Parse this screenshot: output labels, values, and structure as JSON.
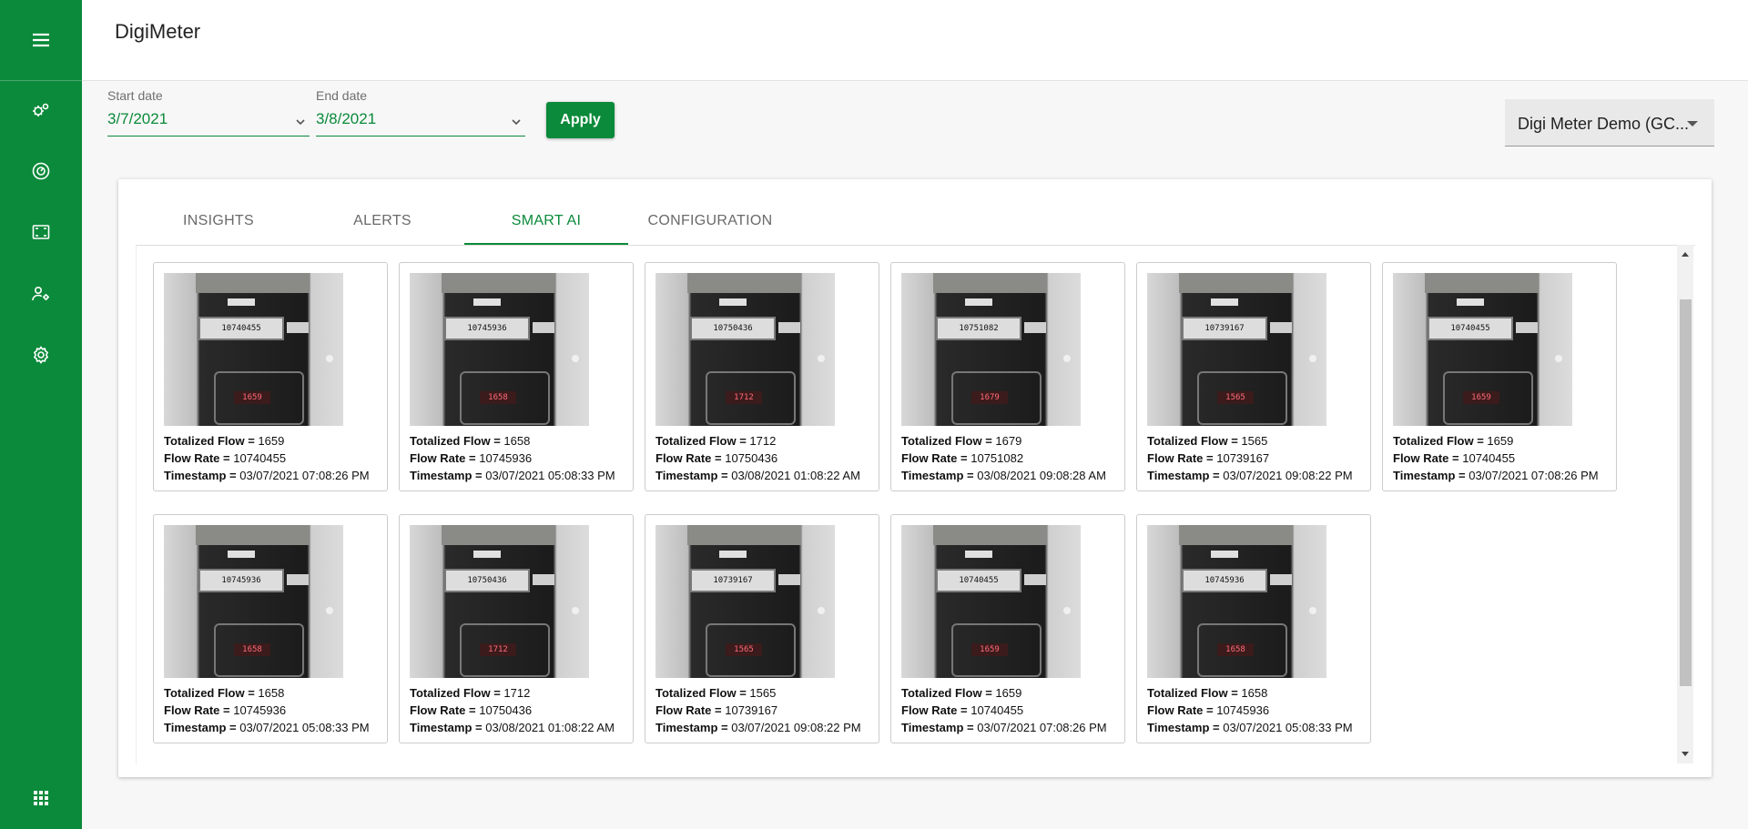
{
  "app": {
    "title": "DigiMeter"
  },
  "filters": {
    "start_date_label": "Start date",
    "start_date_value": "3/7/2021",
    "end_date_label": "End date",
    "end_date_value": "3/8/2021",
    "apply_label": "Apply"
  },
  "org_selector": {
    "value": "Digi Meter Demo (GC..."
  },
  "sidebar": {
    "items": [
      {
        "icon": "menu-icon"
      },
      {
        "icon": "gears-icon"
      },
      {
        "icon": "gauge-icon"
      },
      {
        "icon": "map-frame-icon"
      },
      {
        "icon": "user-settings-icon"
      },
      {
        "icon": "settings-icon"
      },
      {
        "icon": "apps-grid-icon"
      }
    ]
  },
  "tabs": [
    {
      "label": "INSIGHTS",
      "active": false
    },
    {
      "label": "ALERTS",
      "active": false
    },
    {
      "label": "SMART AI",
      "active": true
    },
    {
      "label": "CONFIGURATION",
      "active": false
    }
  ],
  "field_labels": {
    "totalized_flow": "Totalized Flow =",
    "flow_rate": "Flow Rate =",
    "timestamp": "Timestamp ="
  },
  "readings": [
    {
      "totalized_flow": "1659",
      "flow_rate": "10740455",
      "timestamp": "03/07/2021 07:08:26 PM",
      "counter": "10740455",
      "lcd": "1659"
    },
    {
      "totalized_flow": "1658",
      "flow_rate": "10745936",
      "timestamp": "03/07/2021 05:08:33 PM",
      "counter": "10745936",
      "lcd": "1658"
    },
    {
      "totalized_flow": "1712",
      "flow_rate": "10750436",
      "timestamp": "03/08/2021 01:08:22 AM",
      "counter": "10750436",
      "lcd": "1712"
    },
    {
      "totalized_flow": "1679",
      "flow_rate": "10751082",
      "timestamp": "03/08/2021 09:08:28 AM",
      "counter": "10751082",
      "lcd": "1679"
    },
    {
      "totalized_flow": "1565",
      "flow_rate": "10739167",
      "timestamp": "03/07/2021 09:08:22 PM",
      "counter": "10739167",
      "lcd": "1565"
    },
    {
      "totalized_flow": "1659",
      "flow_rate": "10740455",
      "timestamp": "03/07/2021 07:08:26 PM",
      "counter": "10740455",
      "lcd": "1659"
    },
    {
      "totalized_flow": "1658",
      "flow_rate": "10745936",
      "timestamp": "03/07/2021 05:08:33 PM",
      "counter": "10745936",
      "lcd": "1658"
    },
    {
      "totalized_flow": "1712",
      "flow_rate": "10750436",
      "timestamp": "03/08/2021 01:08:22 AM",
      "counter": "10750436",
      "lcd": "1712"
    },
    {
      "totalized_flow": "1565",
      "flow_rate": "10739167",
      "timestamp": "03/07/2021 09:08:22 PM",
      "counter": "10739167",
      "lcd": "1565"
    },
    {
      "totalized_flow": "1659",
      "flow_rate": "10740455",
      "timestamp": "03/07/2021 07:08:26 PM",
      "counter": "10740455",
      "lcd": "1659"
    },
    {
      "totalized_flow": "1658",
      "flow_rate": "10745936",
      "timestamp": "03/07/2021 05:08:33 PM",
      "counter": "10745936",
      "lcd": "1658"
    }
  ],
  "colors": {
    "brand": "#0a8a3a",
    "header_bg": "#ffffff",
    "page_bg": "#f7f7f7"
  }
}
